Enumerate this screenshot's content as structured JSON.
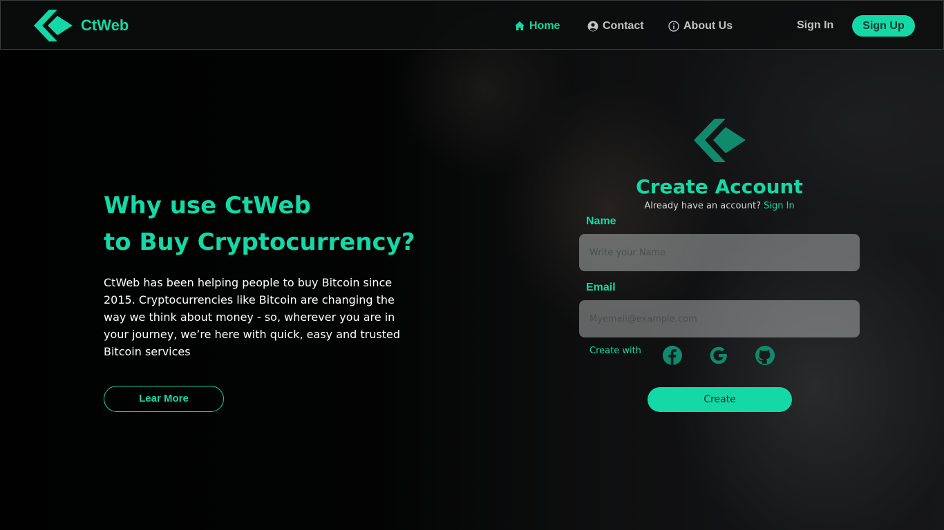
{
  "brand": {
    "name": "CtWeb",
    "accent_color": "#14d9a6"
  },
  "nav": {
    "items": [
      {
        "label": "Home",
        "icon": "home-icon",
        "active": true
      },
      {
        "label": "Contact",
        "icon": "user-circle-icon",
        "active": false
      },
      {
        "label": "About Us",
        "icon": "info-circle-icon",
        "active": false
      }
    ],
    "sign_in": "Sign In",
    "sign_up": "Sign Up"
  },
  "hero": {
    "title_line1": "Why use CtWeb",
    "title_line2": "to Buy Cryptocurrency?",
    "description": "CtWeb has been helping people to buy Bitcoin since 2015. Cryptocurrencies like Bitcoin are changing the way we think about money - so, wherever you are in your journey, we’re here with quick, easy and trusted Bitcoin services",
    "learn_more": "Lear More"
  },
  "form": {
    "title": "Create Account",
    "already_text": "Already have an account?",
    "sign_in_link": "Sign In",
    "name_label": "Name",
    "name_placeholder": "Write your Name",
    "email_label": "Email",
    "email_placeholder": "Myemail@example.com",
    "create_with": "Create with",
    "social": [
      "facebook-icon",
      "google-icon",
      "github-icon"
    ],
    "create_button": "Create"
  }
}
